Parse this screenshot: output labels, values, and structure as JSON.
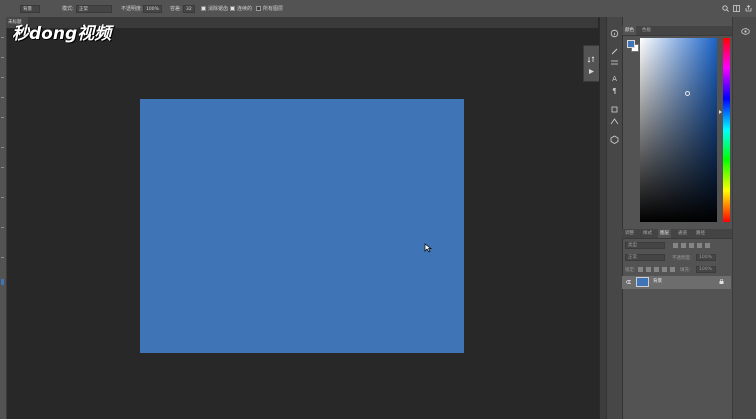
{
  "options_bar": {
    "preset": "背景",
    "mode_label": "模式:",
    "mode_value": "正常",
    "opacity_label": "不透明度:",
    "opacity_value": "100%",
    "tolerance_label": "容差:",
    "tolerance_value": "32",
    "antialias_label": "消除锯齿",
    "contiguous_label": "连续的",
    "all_layers_label": "所有图层"
  },
  "watermark": {
    "text": "秒dong视频"
  },
  "document_tab": {
    "label": "未标题"
  },
  "canvas": {
    "fill_color": "#3f75b6"
  },
  "color_panel": {
    "tabs": [
      "颜色",
      "色板"
    ],
    "foreground_color": "#3f75b6",
    "background_color": "#ffffff"
  },
  "layers_panel": {
    "tabs": [
      "图层",
      "调整",
      "样式",
      "通道",
      "路径"
    ],
    "active_tab": "图层",
    "filter_label": "类型",
    "blend_mode": "正常",
    "opacity_label": "不透明度:",
    "opacity_value": "100%",
    "lock_label": "锁定:",
    "fill_label": "填充:",
    "fill_value": "100%",
    "layers": [
      {
        "name": "背景",
        "visible": true,
        "locked": true,
        "thumb_color": "#3f75b6"
      }
    ]
  },
  "icons": {
    "top_right": [
      "search-icon",
      "workspace-icon",
      "share-icon"
    ],
    "side_strip": [
      "info-icon",
      "brush-icon",
      "adjust-icon",
      "text-icon",
      "paragraph-icon",
      "clone-icon",
      "path-icon",
      "3d-icon"
    ]
  }
}
